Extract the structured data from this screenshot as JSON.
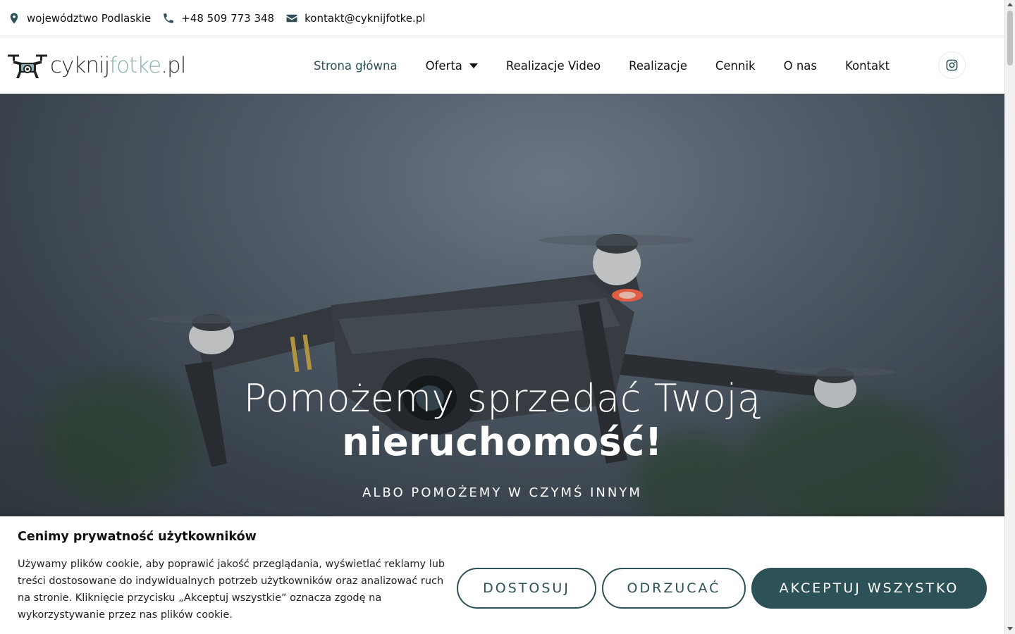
{
  "topbar": {
    "location": "województwo Podlaskie",
    "phone": "+48 509 773 348",
    "email": "kontakt@cyknijfotke.pl"
  },
  "logo": {
    "part1": "cyknij",
    "part2": "fotke",
    "part3": ".pl"
  },
  "nav": {
    "items": [
      {
        "label": "Strona główna",
        "active": true
      },
      {
        "label": "Oferta",
        "dropdown": true
      },
      {
        "label": "Realizacje Video"
      },
      {
        "label": "Realizacje"
      },
      {
        "label": "Cennik"
      },
      {
        "label": "O nas"
      },
      {
        "label": "Kontakt"
      }
    ]
  },
  "hero": {
    "title_line1": "Pomożemy sprzedać Twoją",
    "title_line2": "nieruchomość!",
    "subtitle": "ALBO POMOŻEMY W CZYMŚ INNYM"
  },
  "cookie": {
    "title": "Cenimy prywatność użytkowników",
    "text": "Używamy plików cookie, aby poprawić jakość przeglądania, wyświetlać reklamy lub treści dostosowane do indywidualnych potrzeb użytkowników oraz analizować ruch na stronie. Kliknięcie przycisku „Akceptuj wszystkie” oznacza zgodę na wykorzystywanie przez nas plików cookie.",
    "customize_label": "DOSTOSUJ",
    "reject_label": "ODRZUCAĆ",
    "accept_label": "AKCEPTUJ WSZYSTKO"
  },
  "colors": {
    "accent": "#2c5157",
    "logo_light": "#8bb2b2"
  }
}
